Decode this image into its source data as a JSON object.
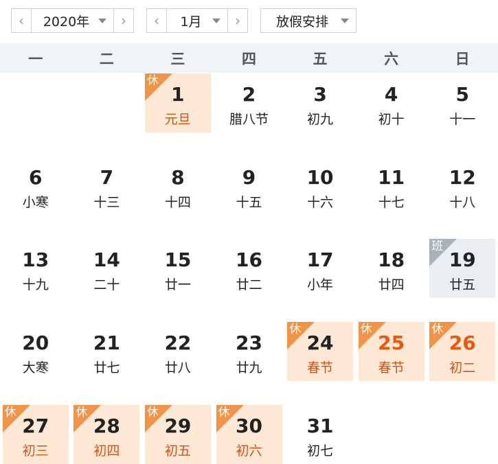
{
  "toolbar": {
    "year_label": "2020年",
    "month_label": "1月",
    "holiday_label": "放假安排",
    "prev_glyph": "‹",
    "next_glyph": "›"
  },
  "weekdays": [
    "一",
    "二",
    "三",
    "四",
    "五",
    "六",
    "日"
  ],
  "colors": {
    "header_bg": "#eff4f6",
    "rest_bg": "#fde8d6",
    "rest_tag": "#f29447",
    "work_bg": "#e9eef2",
    "work_tag": "#a9b3bb",
    "holiday_text": "#d9520f"
  },
  "days": [
    {
      "num": "1",
      "lunar": "元旦",
      "tag": "休",
      "type": "rest"
    },
    {
      "num": "2",
      "lunar": "腊八节"
    },
    {
      "num": "3",
      "lunar": "初九"
    },
    {
      "num": "4",
      "lunar": "初十"
    },
    {
      "num": "5",
      "lunar": "十一"
    },
    {
      "num": "6",
      "lunar": "小寒"
    },
    {
      "num": "7",
      "lunar": "十三"
    },
    {
      "num": "8",
      "lunar": "十四"
    },
    {
      "num": "9",
      "lunar": "十五"
    },
    {
      "num": "10",
      "lunar": "十六"
    },
    {
      "num": "11",
      "lunar": "十七"
    },
    {
      "num": "12",
      "lunar": "十八"
    },
    {
      "num": "13",
      "lunar": "十九"
    },
    {
      "num": "14",
      "lunar": "二十"
    },
    {
      "num": "15",
      "lunar": "廿一"
    },
    {
      "num": "16",
      "lunar": "廿二"
    },
    {
      "num": "17",
      "lunar": "小年"
    },
    {
      "num": "18",
      "lunar": "廿四"
    },
    {
      "num": "19",
      "lunar": "廿五",
      "tag": "班",
      "type": "work"
    },
    {
      "num": "20",
      "lunar": "大寒"
    },
    {
      "num": "21",
      "lunar": "廿七"
    },
    {
      "num": "22",
      "lunar": "廿八"
    },
    {
      "num": "23",
      "lunar": "廿九"
    },
    {
      "num": "24",
      "lunar": "春节",
      "tag": "休",
      "type": "rest"
    },
    {
      "num": "25",
      "lunar": "春节",
      "tag": "休",
      "type": "rest"
    },
    {
      "num": "26",
      "lunar": "初二",
      "tag": "休",
      "type": "rest"
    },
    {
      "num": "27",
      "lunar": "初三",
      "tag": "休",
      "type": "rest"
    },
    {
      "num": "28",
      "lunar": "初四",
      "tag": "休",
      "type": "rest"
    },
    {
      "num": "29",
      "lunar": "初五",
      "tag": "休",
      "type": "rest"
    },
    {
      "num": "30",
      "lunar": "初六",
      "tag": "休",
      "type": "rest"
    },
    {
      "num": "31",
      "lunar": "初七"
    }
  ]
}
